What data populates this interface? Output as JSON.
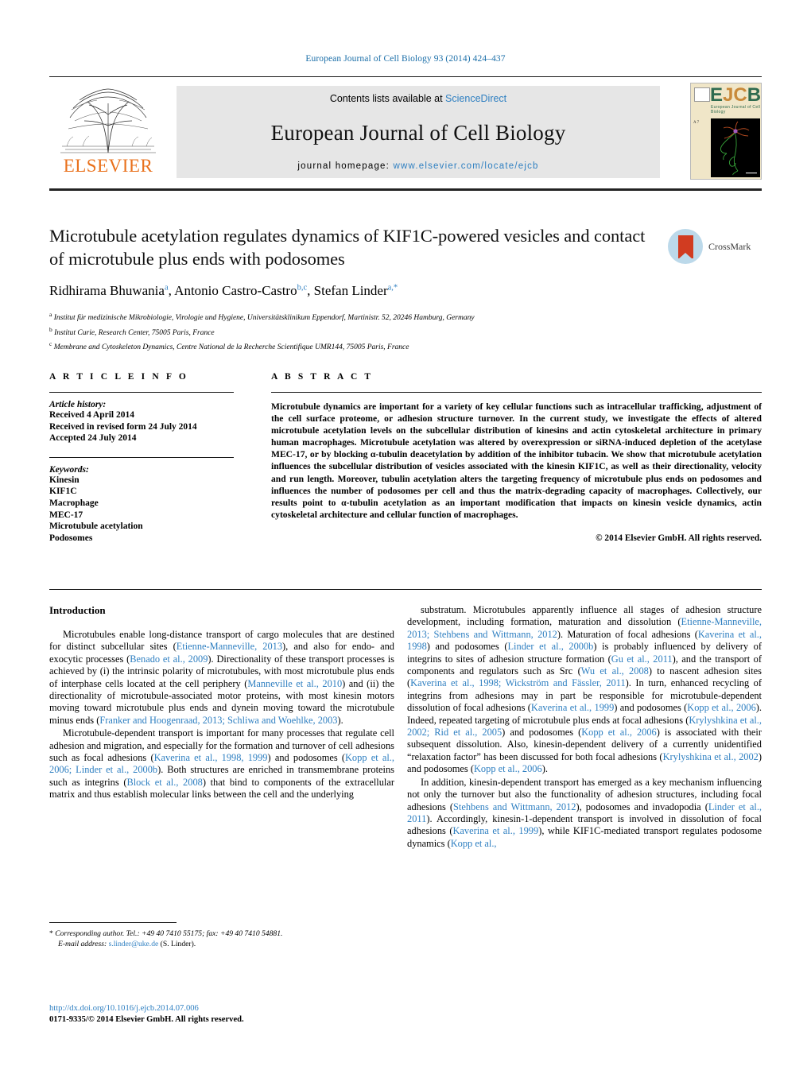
{
  "running_head": "European Journal of Cell Biology 93 (2014) 424–437",
  "masthead": {
    "publisher": "ELSEVIER",
    "contents_prefix": "Contents lists available at ",
    "contents_link": "ScienceDirect",
    "journal_name": "European Journal of Cell Biology",
    "homepage_prefix": "journal homepage:",
    "homepage_url": "www.elsevier.com/locate/ejcb",
    "cover": {
      "letters": "EJCB",
      "subtitle": "European Journal of Cell Biology",
      "left_col": "A 7"
    }
  },
  "article": {
    "title": "Microtubule acetylation regulates dynamics of KIF1C-powered vesicles and contact of microtubule plus ends with podosomes",
    "authors_html": "Ridhirama Bhuwania<sup>a</sup>, Antonio Castro-Castro<sup>b,c</sup>, Stefan Linder<sup>a,*</sup>",
    "affiliations": [
      {
        "marker": "a",
        "text": "Institut für medizinische Mikrobiologie, Virologie und Hygiene, Universitätsklinikum Eppendorf, Martinistr. 52, 20246 Hamburg, Germany"
      },
      {
        "marker": "b",
        "text": "Institut Curie, Research Center, 75005 Paris, France"
      },
      {
        "marker": "c",
        "text": "Membrane and Cytoskeleton Dynamics, Centre National de la Recherche Scientifique UMR144, 75005 Paris, France"
      }
    ],
    "crossmark_label": "CrossMark"
  },
  "article_info": {
    "label": "A R T I C L E    I N F O",
    "history_heading": "Article history:",
    "history": [
      "Received 4 April 2014",
      "Received in revised form 24 July 2014",
      "Accepted 24 July 2014"
    ],
    "keywords_heading": "Keywords:",
    "keywords": [
      "Kinesin",
      "KIF1C",
      "Macrophage",
      "MEC-17",
      "Microtubule acetylation",
      "Podosomes"
    ]
  },
  "abstract": {
    "label": "A B S T R A C T",
    "text": "Microtubule dynamics are important for a variety of key cellular functions such as intracellular trafficking, adjustment of the cell surface proteome, or adhesion structure turnover. In the current study, we investigate the effects of altered microtubule acetylation levels on the subcellular distribution of kinesins and actin cytoskeletal architecture in primary human macrophages. Microtubule acetylation was altered by overexpression or siRNA-induced depletion of the acetylase MEC-17, or by blocking α-tubulin deacetylation by addition of the inhibitor tubacin. We show that microtubule acetylation influences the subcellular distribution of vesicles associated with the kinesin KIF1C, as well as their directionality, velocity and run length. Moreover, tubulin acetylation alters the targeting frequency of microtubule plus ends on podosomes and influences the number of podosomes per cell and thus the matrix-degrading capacity of macrophages. Collectively, our results point to α-tubulin acetylation as an important modification that impacts on kinesin vesicle dynamics, actin cytoskeletal architecture and cellular function of macrophages.",
    "copyright": "© 2014 Elsevier GmbH. All rights reserved."
  },
  "introduction": {
    "heading": "Introduction",
    "left_paragraphs": [
      [
        {
          "t": "Microtubules enable long-distance transport of cargo molecules that are destined for distinct subcellular sites ("
        },
        {
          "t": "Etienne-Manneville, 2013",
          "ref": true
        },
        {
          "t": "), and also for endo- and exocytic processes ("
        },
        {
          "t": "Benado et al., 2009",
          "ref": true
        },
        {
          "t": "). Directionality of these transport processes is achieved by (i) the intrinsic polarity of microtubules, with most microtubule plus ends of interphase cells located at the cell periphery ("
        },
        {
          "t": "Manneville et al., 2010",
          "ref": true
        },
        {
          "t": ") and (ii) the directionality of microtubule-associated motor proteins, with most kinesin motors moving toward microtubule plus ends and dynein moving toward the microtubule minus ends ("
        },
        {
          "t": "Franker and Hoogenraad, 2013; Schliwa and Woehlke, 2003",
          "ref": true
        },
        {
          "t": ")."
        }
      ],
      [
        {
          "t": "Microtubule-dependent transport is important for many processes that regulate cell adhesion and migration, and especially for the formation and turnover of cell adhesions such as focal adhesions ("
        },
        {
          "t": "Kaverina et al., 1998, 1999",
          "ref": true
        },
        {
          "t": ") and podosomes ("
        },
        {
          "t": "Kopp et al., 2006; Linder et al., 2000b",
          "ref": true
        },
        {
          "t": "). Both structures are enriched in transmembrane proteins such as integrins ("
        },
        {
          "t": "Block et al., 2008",
          "ref": true
        },
        {
          "t": ") that bind to components of the extracellular matrix and thus establish molecular links between the cell and the underlying"
        }
      ]
    ],
    "right_paragraphs": [
      [
        {
          "t": "substratum. Microtubules apparently influence all stages of adhesion structure development, including formation, maturation and dissolution ("
        },
        {
          "t": "Etienne-Manneville, 2013; Stehbens and Wittmann, 2012",
          "ref": true
        },
        {
          "t": "). Maturation of focal adhesions ("
        },
        {
          "t": "Kaverina et al., 1998",
          "ref": true
        },
        {
          "t": ") and podosomes ("
        },
        {
          "t": "Linder et al., 2000b",
          "ref": true
        },
        {
          "t": ") is probably influenced by delivery of integrins to sites of adhesion structure formation ("
        },
        {
          "t": "Gu et al., 2011",
          "ref": true
        },
        {
          "t": "), and the transport of components and regulators such as Src ("
        },
        {
          "t": "Wu et al., 2008",
          "ref": true
        },
        {
          "t": ") to nascent adhesion sites ("
        },
        {
          "t": "Kaverina et al., 1998; Wickström and Fässler, 2011",
          "ref": true
        },
        {
          "t": "). In turn, enhanced recycling of integrins from adhesions may in part be responsible for microtubule-dependent dissolution of focal adhesions ("
        },
        {
          "t": "Kaverina et al., 1999",
          "ref": true
        },
        {
          "t": ") and podosomes ("
        },
        {
          "t": "Kopp et al., 2006",
          "ref": true
        },
        {
          "t": "). Indeed, repeated targeting of microtubule plus ends at focal adhesions ("
        },
        {
          "t": "Krylyshkina et al., 2002; Rid et al., 2005",
          "ref": true
        },
        {
          "t": ") and podosomes ("
        },
        {
          "t": "Kopp et al., 2006",
          "ref": true
        },
        {
          "t": ") is associated with their subsequent dissolution. Also, kinesin-dependent delivery of a currently unidentified “relaxation factor” has been discussed for both focal adhesions ("
        },
        {
          "t": "Krylyshkina et al., 2002",
          "ref": true
        },
        {
          "t": ") and podosomes ("
        },
        {
          "t": "Kopp et al., 2006",
          "ref": true
        },
        {
          "t": ")."
        }
      ],
      [
        {
          "t": "In addition, kinesin-dependent transport has emerged as a key mechanism influencing not only the turnover but also the functionality of adhesion structures, including focal adhesions ("
        },
        {
          "t": "Stehbens and Wittmann, 2012",
          "ref": true
        },
        {
          "t": "), podosomes and invadopodia ("
        },
        {
          "t": "Linder et al., 2011",
          "ref": true
        },
        {
          "t": "). Accordingly, kinesin-1-dependent transport is involved in dissolution of focal adhesions ("
        },
        {
          "t": "Kaverina et al., 1999",
          "ref": true
        },
        {
          "t": "), while KIF1C-mediated transport regulates podosome dynamics ("
        },
        {
          "t": "Kopp et al.,",
          "ref": true
        }
      ]
    ]
  },
  "footnote": {
    "marker": "*",
    "corresponding": "Corresponding author. Tel.: +49 40 7410 55175; fax: +49 40 7410 54881.",
    "email_label": "E-mail address:",
    "email": "s.linder@uke.de",
    "email_suffix": "(S. Linder)."
  },
  "doi_block": {
    "doi": "http://dx.doi.org/10.1016/j.ejcb.2014.07.006",
    "issn": "0171-9335/© 2014 Elsevier GmbH. All rights reserved."
  }
}
